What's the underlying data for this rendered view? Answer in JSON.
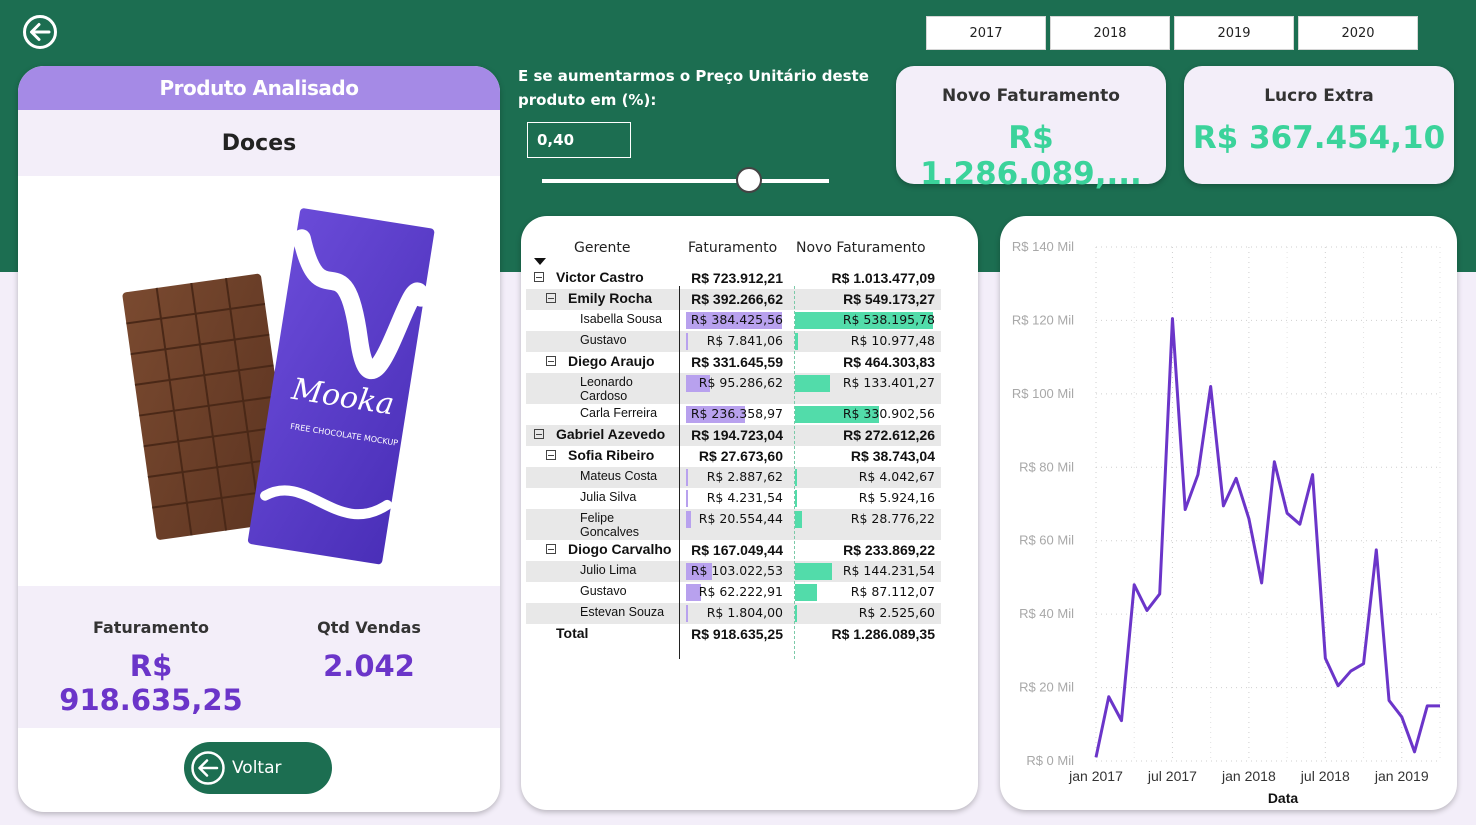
{
  "header": {
    "back_icon": "arrow-left-circle-icon",
    "years": [
      "2017",
      "2018",
      "2019",
      "2020"
    ]
  },
  "product": {
    "header": "Produto Analisado",
    "name": "Doces",
    "image_icon": "chocolate-bar-image",
    "stats": {
      "faturamento_label": "Faturamento",
      "faturamento_value": "R$ 918.635,25",
      "qtd_label": "Qtd Vendas",
      "qtd_value": "2.042"
    },
    "voltar_label": "Voltar"
  },
  "simulation": {
    "question": "E se aumentarmos o Preço Unitário deste produto em (%):",
    "value": "0,40",
    "slider_fraction": 0.72
  },
  "kpis": {
    "novo_faturamento_label": "Novo Faturamento",
    "novo_faturamento_value": "R$ 1.286.089,...",
    "lucro_extra_label": "Lucro Extra",
    "lucro_extra_value": "R$ 367.454,10"
  },
  "matrix": {
    "columns": [
      "Gerente",
      "Faturamento",
      "Novo Faturamento"
    ],
    "rows": [
      {
        "level": 0,
        "name": "Victor Castro",
        "fat": "R$ 723.912,21",
        "novo": "R$ 1.013.477,09",
        "expander": true,
        "bold": true
      },
      {
        "level": 1,
        "name": "Emily Rocha",
        "fat": "R$ 392.266,62",
        "novo": "R$ 549.173,27",
        "expander": true,
        "bold": true,
        "shaded": true
      },
      {
        "level": 2,
        "name": "Isabella Sousa",
        "fat": "R$ 384.425,56",
        "novo": "R$ 538.195,78",
        "bar": 1.0
      },
      {
        "level": 2,
        "name": "Gustavo",
        "fat": "R$ 7.841,06",
        "novo": "R$ 10.977,48",
        "bar": 0.02,
        "shaded": true
      },
      {
        "level": 1,
        "name": "Diego Araujo",
        "fat": "R$ 331.645,59",
        "novo": "R$ 464.303,83",
        "expander": true,
        "bold": true
      },
      {
        "level": 2,
        "name": "Leonardo Cardoso",
        "fat": "R$ 95.286,62",
        "novo": "R$ 133.401,27",
        "bar": 0.25,
        "shaded": true,
        "tall": true
      },
      {
        "level": 2,
        "name": "Carla Ferreira",
        "fat": "R$ 236.358,97",
        "novo": "R$ 330.902,56",
        "bar": 0.61
      },
      {
        "level": 0,
        "name": "Gabriel Azevedo",
        "fat": "R$ 194.723,04",
        "novo": "R$ 272.612,26",
        "expander": true,
        "bold": true,
        "shaded": true
      },
      {
        "level": 1,
        "name": "Sofia Ribeiro",
        "fat": "R$ 27.673,60",
        "novo": "R$ 38.743,04",
        "expander": true,
        "bold": true
      },
      {
        "level": 2,
        "name": "Mateus Costa",
        "fat": "R$ 2.887,62",
        "novo": "R$ 4.042,67",
        "bar": 0.008,
        "shaded": true
      },
      {
        "level": 2,
        "name": "Julia Silva",
        "fat": "R$ 4.231,54",
        "novo": "R$ 5.924,16",
        "bar": 0.011
      },
      {
        "level": 2,
        "name": "Felipe Goncalves",
        "fat": "R$ 20.554,44",
        "novo": "R$ 28.776,22",
        "bar": 0.053,
        "shaded": true,
        "tall": true
      },
      {
        "level": 1,
        "name": "Diogo Carvalho",
        "fat": "R$ 167.049,44",
        "novo": "R$ 233.869,22",
        "expander": true,
        "bold": true
      },
      {
        "level": 2,
        "name": "Julio Lima",
        "fat": "R$ 103.022,53",
        "novo": "R$ 144.231,54",
        "bar": 0.27,
        "shaded": true
      },
      {
        "level": 2,
        "name": "Gustavo",
        "fat": "R$ 62.222,91",
        "novo": "R$ 87.112,07",
        "bar": 0.16
      },
      {
        "level": 2,
        "name": "Estevan Souza",
        "fat": "R$ 1.804,00",
        "novo": "R$ 2.525,60",
        "bar": 0.005,
        "shaded": true
      },
      {
        "level": 0,
        "name": "Total",
        "fat": "R$ 918.635,25",
        "novo": "R$ 1.286.089,35",
        "bold": true,
        "total": true
      }
    ],
    "bar_colors": {
      "faturamento": "#b8a1ee",
      "novo": "#52dcaa"
    }
  },
  "chart_data": {
    "type": "line",
    "xlabel": "Data",
    "ylabel": "",
    "x_tick_labels": [
      "jan 2017",
      "jul 2017",
      "jan 2018",
      "jul 2018",
      "jan 2019"
    ],
    "y_tick_labels": [
      "R$ 0 Mil",
      "R$ 20 Mil",
      "R$ 40 Mil",
      "R$ 60 Mil",
      "R$ 80 Mil",
      "R$ 100 Mil",
      "R$ 120 Mil",
      "R$ 140 Mil"
    ],
    "ylim": [
      0,
      140000
    ],
    "color": "#6b35c9",
    "series": [
      {
        "x": [
          "2017-01",
          "2017-02",
          "2017-03",
          "2017-04",
          "2017-05",
          "2017-06",
          "2017-07",
          "2017-08",
          "2017-09",
          "2017-10",
          "2017-11",
          "2017-12",
          "2018-01",
          "2018-02",
          "2018-03",
          "2018-04",
          "2018-05",
          "2018-06",
          "2018-07",
          "2018-08",
          "2018-09",
          "2018-10",
          "2018-11",
          "2018-12",
          "2019-01",
          "2019-02",
          "2019-03",
          "2019-04"
        ],
        "values": [
          1000,
          17500,
          11000,
          48000,
          41000,
          45500,
          120500,
          68500,
          78000,
          102000,
          69500,
          77000,
          66000,
          48500,
          81500,
          67500,
          64500,
          78000,
          28000,
          20500,
          24500,
          26500,
          57500,
          16500,
          12000,
          2500,
          15000,
          15000
        ]
      }
    ],
    "grid": "dotted horizontal and vertical"
  }
}
